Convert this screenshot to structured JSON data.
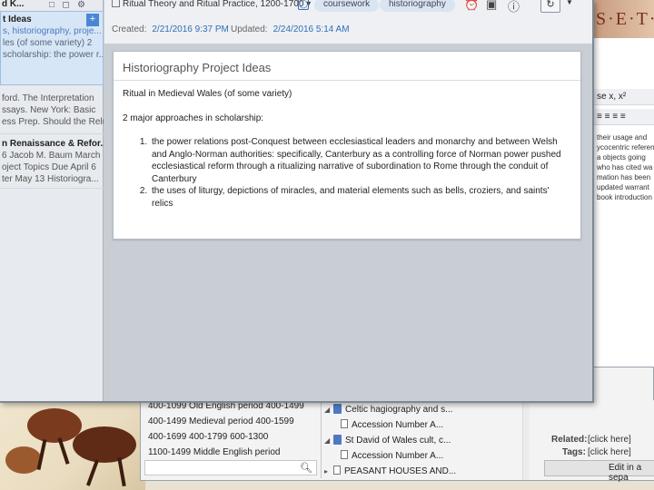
{
  "background": {
    "banner_text": "S·E·T·"
  },
  "note_list": {
    "items": [
      {
        "title": "d K...",
        "body": ""
      },
      {
        "title": "t Ideas",
        "body": "s, historiography, proje...",
        "body2": "les (of some variety) 2",
        "body3": "scholarship: the power r...",
        "selected": true
      },
      {
        "title": "",
        "body": "ford. The Interpretation",
        "body2": "ssays. New York: Basic",
        "body3": "ess Prep. Should the Relu..."
      },
      {
        "title": "n Renaissance & Refor...",
        "body": "6     Jacob M. Baum March",
        "body2": "oject Topics Due April 6",
        "body3": "ter May 13    Historiogra..."
      }
    ]
  },
  "editor": {
    "notebook": "Ritual Theory and Ritual Practice, 1200-1700",
    "tags": [
      "coursework",
      "historiography"
    ],
    "created_label": "Created:",
    "created_value": "2/21/2016 9:37 PM",
    "updated_label": "Updated:",
    "updated_value": "2/24/2016 5:14 AM"
  },
  "note": {
    "title": "Historiography Project Ideas",
    "line1": "Ritual in Medieval Wales (of some variety)",
    "line2": "2 major approaches in scholarship:",
    "items": [
      "the power relations post-Conquest between ecclesiastical leaders and monarchy and between Welsh and Anglo-Norman authorities: specifically, Canterbury as a controlling force of Norman power pushed ecclesiastical reform through a ritualizing narrative of subordination to Rome through the conduit of Canterbury",
      "the uses of liturgy, depictions of miracles, and material elements such as bells, croziers, and saints' relics"
    ]
  },
  "back_window": {
    "periods": [
      "400-1099 Old English period    400-1499",
      "400-1499 Medieval period    400-1599",
      "400-1699    400-1799    600-1300",
      "1100-1499 Middle English period"
    ],
    "tree": [
      {
        "label": "Celtic hagiography and s...",
        "type": "notebook",
        "expanded": true
      },
      {
        "label": "Accession Number A...",
        "type": "doc",
        "indent": true
      },
      {
        "label": "St David of Wales cult, c...",
        "type": "notebook",
        "expanded": true
      },
      {
        "label": "Accession Number A...",
        "type": "doc",
        "indent": true
      },
      {
        "label": "PEASANT HOUSES AND...",
        "type": "doc",
        "expanded": false
      }
    ],
    "related_label": "Related:",
    "related_value": "[click here]",
    "tags_label": "Tags:",
    "tags_value": "[click here]",
    "edit_label": "Edit in a sepa"
  },
  "wp_panel": {
    "toolbar1": "se  x,  x²",
    "toolbar2": "≡ ≡ ≡ ≡",
    "text": [
      "their usage and",
      "",
      "",
      "",
      "ycocentric referen",
      "a objects  going",
      "who has cited wa",
      "mation has been",
      "updated warrant",
      "book introduction"
    ]
  }
}
